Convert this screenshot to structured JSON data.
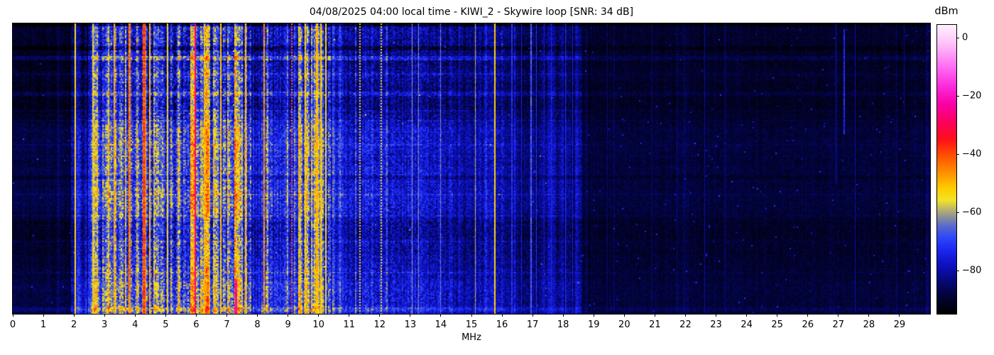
{
  "figure": {
    "title": "04/08/2025 04:00 local time - KIWI_2 - Skywire loop [SNR: 34 dB]",
    "xlabel": "MHz",
    "colorbar_label": "dBm"
  },
  "chart_data": {
    "type": "heatmap",
    "title": "04/08/2025 04:00 local time - KIWI_2 - Skywire loop [SNR: 34 dB]",
    "xlabel": "MHz",
    "ylabel": "",
    "x_range_mhz": [
      0,
      30
    ],
    "x_ticks": [
      0,
      1,
      2,
      3,
      4,
      5,
      6,
      7,
      8,
      9,
      10,
      11,
      12,
      13,
      14,
      15,
      16,
      17,
      18,
      19,
      20,
      21,
      22,
      23,
      24,
      25,
      26,
      27,
      28,
      29
    ],
    "grid": false,
    "legend": "none",
    "colorbar": {
      "label": "dBm",
      "ticks": [
        0,
        -20,
        -40,
        -60,
        -80
      ],
      "vmax": 4.3,
      "vmin": -95
    },
    "colormap_stops": [
      [
        4.3,
        [
          255,
          240,
          255
        ]
      ],
      [
        -2,
        [
          255,
          195,
          250
        ]
      ],
      [
        -10,
        [
          255,
          110,
          243
        ]
      ],
      [
        -17,
        [
          252,
          40,
          220
        ]
      ],
      [
        -23,
        [
          248,
          0,
          165
        ]
      ],
      [
        -29,
        [
          250,
          0,
          95
        ]
      ],
      [
        -35,
        [
          255,
          15,
          25
        ]
      ],
      [
        -41,
        [
          255,
          85,
          0
        ]
      ],
      [
        -47,
        [
          255,
          150,
          0
        ]
      ],
      [
        -52,
        [
          255,
          205,
          0
        ]
      ],
      [
        -56,
        [
          240,
          228,
          40
        ]
      ],
      [
        -59,
        [
          190,
          182,
          105
        ]
      ],
      [
        -62,
        [
          135,
          142,
          155
        ]
      ],
      [
        -65,
        [
          88,
          105,
          205
        ]
      ],
      [
        -69,
        [
          45,
          70,
          250
        ]
      ],
      [
        -73,
        [
          28,
          40,
          242
        ]
      ],
      [
        -78,
        [
          14,
          18,
          195
        ]
      ],
      [
        -83,
        [
          7,
          9,
          130
        ]
      ],
      [
        -88,
        [
          3,
          4,
          65
        ]
      ],
      [
        -95,
        [
          0,
          0,
          0
        ]
      ]
    ],
    "noise_seed": 7,
    "bands": [
      {
        "f0": 0.0,
        "f1": 1.9,
        "base": -90,
        "noise": 2.5,
        "colVar": 1,
        "stripe": 0.03,
        "boost": 4,
        "rowSens": 0.9,
        "speckle": 0.001,
        "grad": 0
      },
      {
        "f0": 1.9,
        "f1": 2.07,
        "base": -83,
        "noise": 5,
        "colVar": 3,
        "stripe": 0.1,
        "boost": 6,
        "rowSens": 1.3,
        "speckle": 0.001,
        "grad": 2
      },
      {
        "f0": 2.07,
        "f1": 2.55,
        "base": -84,
        "noise": 5,
        "colVar": 3,
        "stripe": 0.1,
        "boost": 7,
        "rowSens": 1.3,
        "speckle": 0.001,
        "grad": 8
      },
      {
        "f0": 2.55,
        "f1": 3.4,
        "base": -75,
        "noise": 8,
        "colVar": 5,
        "stripe": 0.3,
        "boost": 13,
        "rowSens": 2.0,
        "speckle": 0.002,
        "grad": 3
      },
      {
        "f0": 3.4,
        "f1": 4.6,
        "base": -73,
        "noise": 9,
        "colVar": 6,
        "stripe": 0.32,
        "boost": 14,
        "rowSens": 2.0,
        "speckle": 0.003,
        "grad": 3
      },
      {
        "f0": 4.6,
        "f1": 5.6,
        "base": -75,
        "noise": 9,
        "colVar": 6,
        "stripe": 0.26,
        "boost": 13,
        "rowSens": 2.0,
        "speckle": 0.002,
        "grad": 3
      },
      {
        "f0": 5.6,
        "f1": 7.78,
        "base": -72,
        "noise": 9,
        "colVar": 6,
        "stripe": 0.38,
        "boost": 15,
        "rowSens": 2.0,
        "speckle": 0.003,
        "grad": 3
      },
      {
        "f0": 7.78,
        "f1": 8.12,
        "base": -79,
        "noise": 6,
        "colVar": 4,
        "stripe": 0.12,
        "boost": 8,
        "rowSens": 1.6,
        "speckle": 0.001,
        "grad": 2
      },
      {
        "f0": 8.12,
        "f1": 8.48,
        "base": -75,
        "noise": 8,
        "colVar": 5,
        "stripe": 0.28,
        "boost": 12,
        "rowSens": 1.8,
        "speckle": 0.002,
        "grad": 2
      },
      {
        "f0": 8.48,
        "f1": 9.32,
        "base": -78,
        "noise": 7,
        "colVar": 4,
        "stripe": 0.16,
        "boost": 9,
        "rowSens": 1.6,
        "speckle": 0.001,
        "grad": 2
      },
      {
        "f0": 9.32,
        "f1": 10.38,
        "base": -74,
        "noise": 9,
        "colVar": 6,
        "stripe": 0.34,
        "boost": 14,
        "rowSens": 1.8,
        "speckle": 0.002,
        "grad": 2
      },
      {
        "f0": 10.38,
        "f1": 11.6,
        "base": -80,
        "noise": 6,
        "colVar": 3.5,
        "stripe": 0.12,
        "boost": 7,
        "rowSens": 1.5,
        "speckle": 0.001,
        "grad": 1
      },
      {
        "f0": 11.6,
        "f1": 12.3,
        "base": -79,
        "noise": 6.5,
        "colVar": 4,
        "stripe": 0.18,
        "boost": 9,
        "rowSens": 1.5,
        "speckle": 0.001,
        "grad": 1
      },
      {
        "f0": 12.3,
        "f1": 13.4,
        "base": -80,
        "noise": 6,
        "colVar": 3.5,
        "stripe": 0.14,
        "boost": 7,
        "rowSens": 1.4,
        "speckle": 0.001,
        "grad": 1
      },
      {
        "f0": 13.4,
        "f1": 14.4,
        "base": -81,
        "noise": 5.5,
        "colVar": 3,
        "stripe": 0.12,
        "boost": 6,
        "rowSens": 1.4,
        "speckle": 0.001,
        "grad": 1
      },
      {
        "f0": 14.4,
        "f1": 15.1,
        "base": -84,
        "noise": 4.5,
        "colVar": 2.5,
        "stripe": 0.08,
        "boost": 5,
        "rowSens": 1.2,
        "speckle": 0.001,
        "grad": 0
      },
      {
        "f0": 15.1,
        "f1": 15.7,
        "base": -82,
        "noise": 5,
        "colVar": 3,
        "stripe": 0.12,
        "boost": 6,
        "rowSens": 1.2,
        "speckle": 0.001,
        "grad": 0
      },
      {
        "f0": 15.7,
        "f1": 16.05,
        "base": -81,
        "noise": 5.5,
        "colVar": 3,
        "stripe": 0.1,
        "boost": 6,
        "rowSens": 1.2,
        "speckle": 0.001,
        "grad": 0
      },
      {
        "f0": 16.05,
        "f1": 18.6,
        "base": -85,
        "noise": 4,
        "colVar": 2.5,
        "stripe": 0.1,
        "boost": 5,
        "rowSens": 1.1,
        "speckle": 0.002,
        "grad": 0
      },
      {
        "f0": 18.6,
        "f1": 30.0,
        "base": -90,
        "noise": 2.2,
        "colVar": 1,
        "stripe": 0.02,
        "boost": 3,
        "rowSens": 0.5,
        "speckle": 0.004,
        "grad": 0
      }
    ],
    "carriers": [
      {
        "f": 2.045,
        "w": 2,
        "level": -54,
        "jit": 3
      },
      {
        "f": 2.62,
        "w": 2,
        "level": -56,
        "jit": 4
      },
      {
        "f": 3.33,
        "w": 2,
        "level": -49,
        "jit": 4
      },
      {
        "f": 3.82,
        "w": 3,
        "level": -45,
        "jit": 5
      },
      {
        "f": 4.29,
        "w": 4,
        "level": -40,
        "jit": 5
      },
      {
        "f": 4.47,
        "w": 2,
        "level": -51,
        "jit": 4
      },
      {
        "f": 5.06,
        "w": 2,
        "level": -55,
        "jit": 4
      },
      {
        "f": 5.96,
        "w": 2,
        "level": -27,
        "jit": 3
      },
      {
        "f": 6.28,
        "w": 2,
        "level": -50,
        "jit": 4
      },
      {
        "f": 6.8,
        "w": 2,
        "level": -52,
        "jit": 4
      },
      {
        "f": 7.3,
        "w": 3,
        "level": -22,
        "jit": 2,
        "y0": 0.885
      },
      {
        "f": 7.62,
        "w": 2,
        "level": -50,
        "jit": 4
      },
      {
        "f": 8.22,
        "w": 2,
        "level": -47,
        "jit": 5
      },
      {
        "f": 9.12,
        "w": 2,
        "level": -42,
        "jit": 4,
        "dotted": true
      },
      {
        "f": 9.57,
        "w": 2,
        "level": -52,
        "jit": 4
      },
      {
        "f": 9.95,
        "w": 3,
        "level": -50,
        "jit": 3
      },
      {
        "f": 10.07,
        "w": 2,
        "level": -53,
        "jit": 3
      },
      {
        "f": 10.24,
        "w": 2,
        "level": -55,
        "jit": 4
      },
      {
        "f": 11.35,
        "w": 2,
        "level": -54,
        "jit": 3,
        "dotted": true
      },
      {
        "f": 12.06,
        "w": 2,
        "level": -55,
        "jit": 3,
        "dotted": true
      },
      {
        "f": 13.05,
        "w": 1,
        "level": -62,
        "jit": 3
      },
      {
        "f": 13.28,
        "w": 1,
        "level": -63,
        "jit": 3
      },
      {
        "f": 14.0,
        "w": 1,
        "level": -64,
        "jit": 4
      },
      {
        "f": 15.13,
        "w": 1,
        "level": -60,
        "jit": 4
      },
      {
        "f": 15.755,
        "w": 2,
        "level": -53,
        "jit": 2.5
      },
      {
        "f": 16.33,
        "w": 2,
        "level": -72,
        "jit": 3
      },
      {
        "f": 16.63,
        "w": 1,
        "level": -75,
        "jit": 3
      },
      {
        "f": 16.95,
        "w": 2,
        "level": -67,
        "jit": 4
      },
      {
        "f": 17.12,
        "w": 1,
        "level": -72,
        "jit": 3
      },
      {
        "f": 17.38,
        "w": 1,
        "level": -76,
        "jit": 3
      },
      {
        "f": 17.62,
        "w": 1,
        "level": -74,
        "jit": 3
      },
      {
        "f": 18.08,
        "w": 1,
        "level": -73,
        "jit": 3
      },
      {
        "f": 18.32,
        "w": 1,
        "level": -75,
        "jit": 3
      },
      {
        "f": 19.45,
        "w": 1,
        "level": -84,
        "jit": 2
      },
      {
        "f": 20.9,
        "w": 1,
        "level": -85,
        "jit": 2
      },
      {
        "f": 22.62,
        "w": 1,
        "level": -81,
        "jit": 2
      },
      {
        "f": 23.3,
        "w": 1,
        "level": -84,
        "jit": 2
      },
      {
        "f": 26.93,
        "w": 1,
        "level": -79,
        "jit": 2,
        "y1": 0.55
      },
      {
        "f": 27.18,
        "w": 2,
        "level": -73,
        "jit": 3,
        "y0": 0.02,
        "y1": 0.38
      },
      {
        "f": 27.55,
        "w": 1,
        "level": -80,
        "jit": 2
      },
      {
        "f": 29.15,
        "w": 1,
        "level": -83,
        "jit": 2,
        "y1": 0.3
      }
    ],
    "bright_rows": [
      {
        "frac": 0.0,
        "amp": -7,
        "span": 1
      },
      {
        "frac": 0.085,
        "amp": -4,
        "span": 1
      },
      {
        "frac": 0.118,
        "amp": 6.5,
        "span": 1
      },
      {
        "frac": 0.17,
        "amp": 2.5,
        "span": 0
      },
      {
        "frac": 0.24,
        "amp": 3.5,
        "span": 1
      },
      {
        "frac": 0.3,
        "amp": 2.5,
        "span": 0
      },
      {
        "frac": 0.335,
        "amp": 3,
        "span": 0
      },
      {
        "frac": 0.415,
        "amp": 2.5,
        "span": 0
      },
      {
        "frac": 0.455,
        "amp": 3,
        "span": 0
      },
      {
        "frac": 0.53,
        "amp": -3,
        "span": 1
      },
      {
        "frac": 0.59,
        "amp": 3,
        "span": 0
      },
      {
        "frac": 0.66,
        "amp": 2.5,
        "span": 0
      },
      {
        "frac": 0.75,
        "amp": 2.5,
        "span": 0
      },
      {
        "frac": 0.86,
        "amp": 2.5,
        "span": 0
      },
      {
        "frac": 0.985,
        "amp": 4,
        "span": 1
      }
    ]
  }
}
